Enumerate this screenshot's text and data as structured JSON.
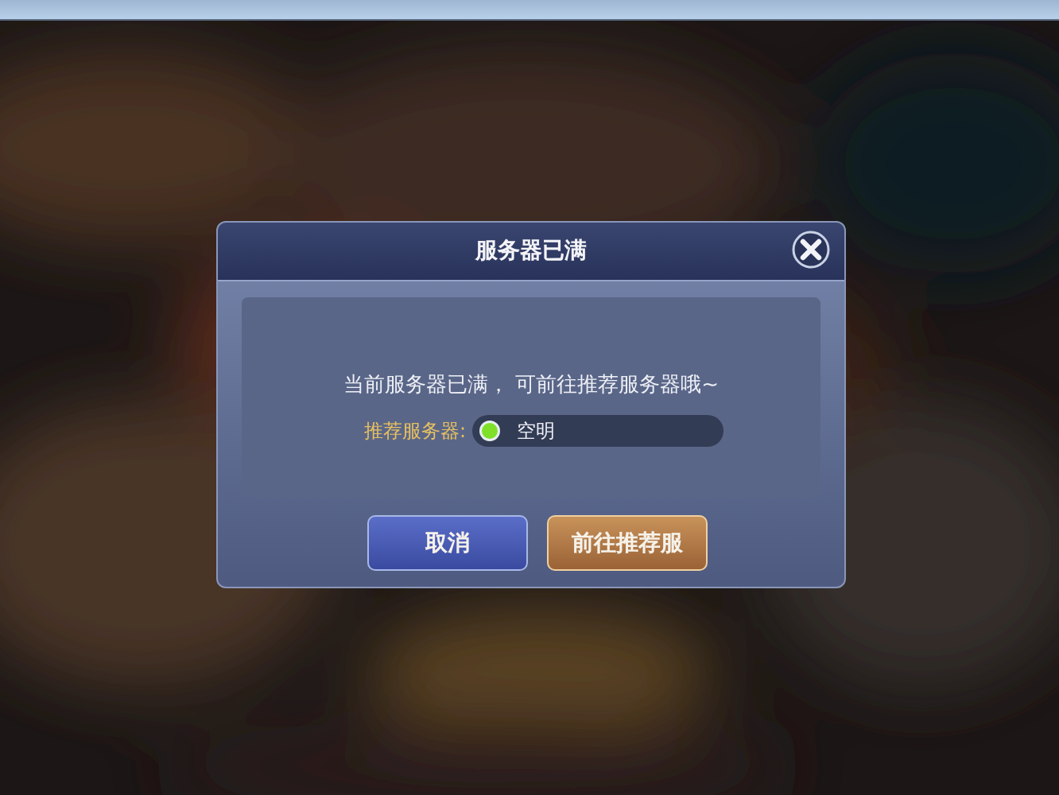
{
  "dialog": {
    "title": "服务器已满",
    "message": "当前服务器已满， 可前往推荐服务器哦~",
    "recommended": {
      "label": "推荐服务器:",
      "server": "空明"
    },
    "buttons": [
      {
        "label": "取消",
        "kind": "cancel"
      },
      {
        "label": "前往推荐服",
        "kind": "confirm"
      }
    ]
  }
}
